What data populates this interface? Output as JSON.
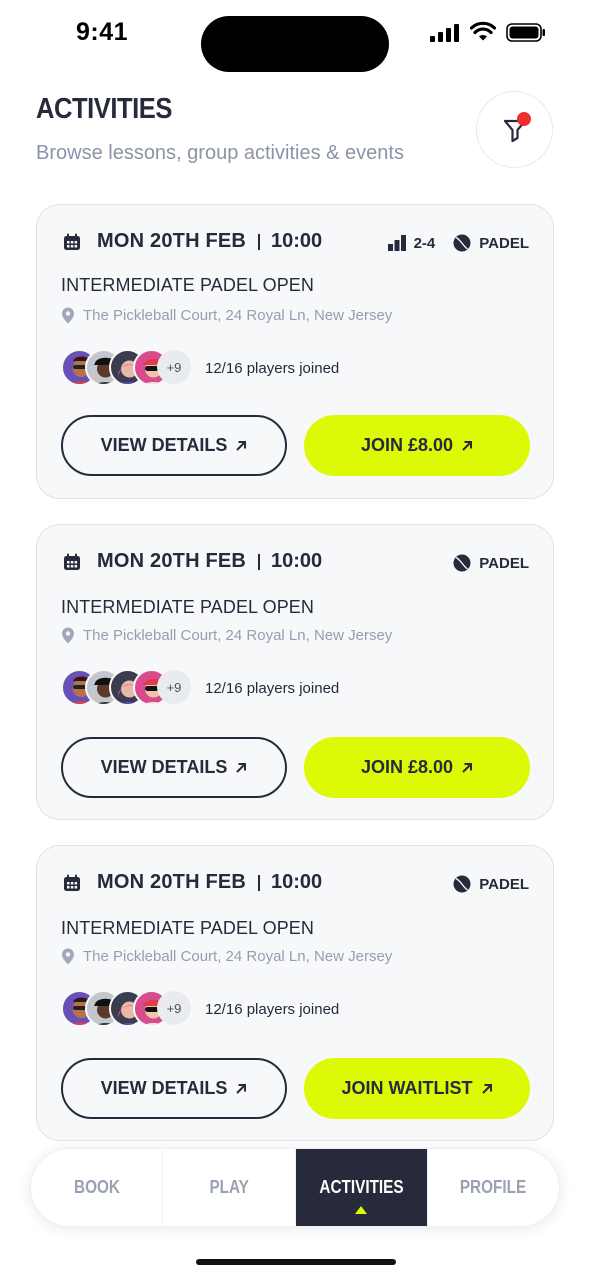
{
  "status_bar": {
    "time": "9:41"
  },
  "header": {
    "title": "ACTIVITIES",
    "subtitle": "Browse lessons, group activities & events"
  },
  "cards": [
    {
      "date": "MON 20TH FEB",
      "time": "10:00",
      "level": "2-4",
      "sport": "PADEL",
      "title": "INTERMEDIATE PADEL OPEN",
      "location": "The Pickleball Court, 24 Royal Ln, New Jersey",
      "more_players": "+9",
      "players_joined": "12/16 players joined",
      "view_label": "VIEW DETAILS",
      "join_label": "JOIN £8.00"
    },
    {
      "date": "MON 20TH FEB",
      "time": "10:00",
      "sport": "PADEL",
      "title": "INTERMEDIATE PADEL OPEN",
      "location": "The Pickleball Court, 24 Royal Ln, New Jersey",
      "more_players": "+9",
      "players_joined": "12/16 players joined",
      "view_label": "VIEW DETAILS",
      "join_label": "JOIN £8.00"
    },
    {
      "date": "MON 20TH FEB",
      "time": "10:00",
      "sport": "PADEL",
      "title": "INTERMEDIATE PADEL OPEN",
      "location": "The Pickleball Court, 24 Royal Ln, New Jersey",
      "more_players": "+9",
      "players_joined": "12/16 players joined",
      "view_label": "VIEW DETAILS",
      "join_label": "JOIN WAITLIST"
    }
  ],
  "tabbar": {
    "items": [
      {
        "label": "BOOK"
      },
      {
        "label": "PLAY"
      },
      {
        "label": "ACTIVITIES"
      },
      {
        "label": "PROFILE"
      }
    ],
    "active": "ACTIVITIES"
  },
  "colors": {
    "accent": "#dcfa06",
    "dark": "#262a3b",
    "muted": "#8c93a8",
    "notification": "#f02d2d"
  }
}
